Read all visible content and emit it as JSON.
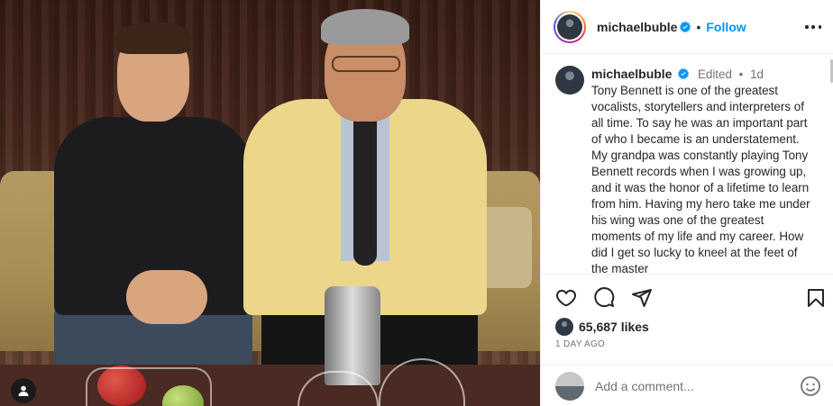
{
  "post": {
    "username": "michaelbuble",
    "follow_label": "Follow",
    "separator": "•"
  },
  "caption": {
    "username": "michaelbuble",
    "edited": "Edited",
    "separator": "•",
    "age": "1d",
    "text": "Tony Bennett is one of the greatest vocalists, storytellers and interpreters of all time. To say he was an important part of who I became is an understatement. My grandpa was constantly playing Tony Bennett records when I was growing up, and it was the honor of a lifetime to learn from him. Having my hero take me under his wing was one of the greatest moments of my life and my career. How did I get so lucky to kneel at the feet of the master"
  },
  "engagement": {
    "likes": "65,687 likes",
    "time": "1 DAY AGO"
  },
  "comment": {
    "placeholder": "Add a comment..."
  },
  "icons": {
    "more": "more-icon",
    "like": "heart-icon",
    "comment": "comment-icon",
    "share": "share-icon",
    "save": "bookmark-icon",
    "emoji": "emoji-icon",
    "verified": "verified-badge-icon",
    "tagged": "user-tag-icon"
  },
  "colors": {
    "accent": "#0095f6",
    "text": "#262626",
    "muted": "#737373",
    "border": "#efefef"
  }
}
